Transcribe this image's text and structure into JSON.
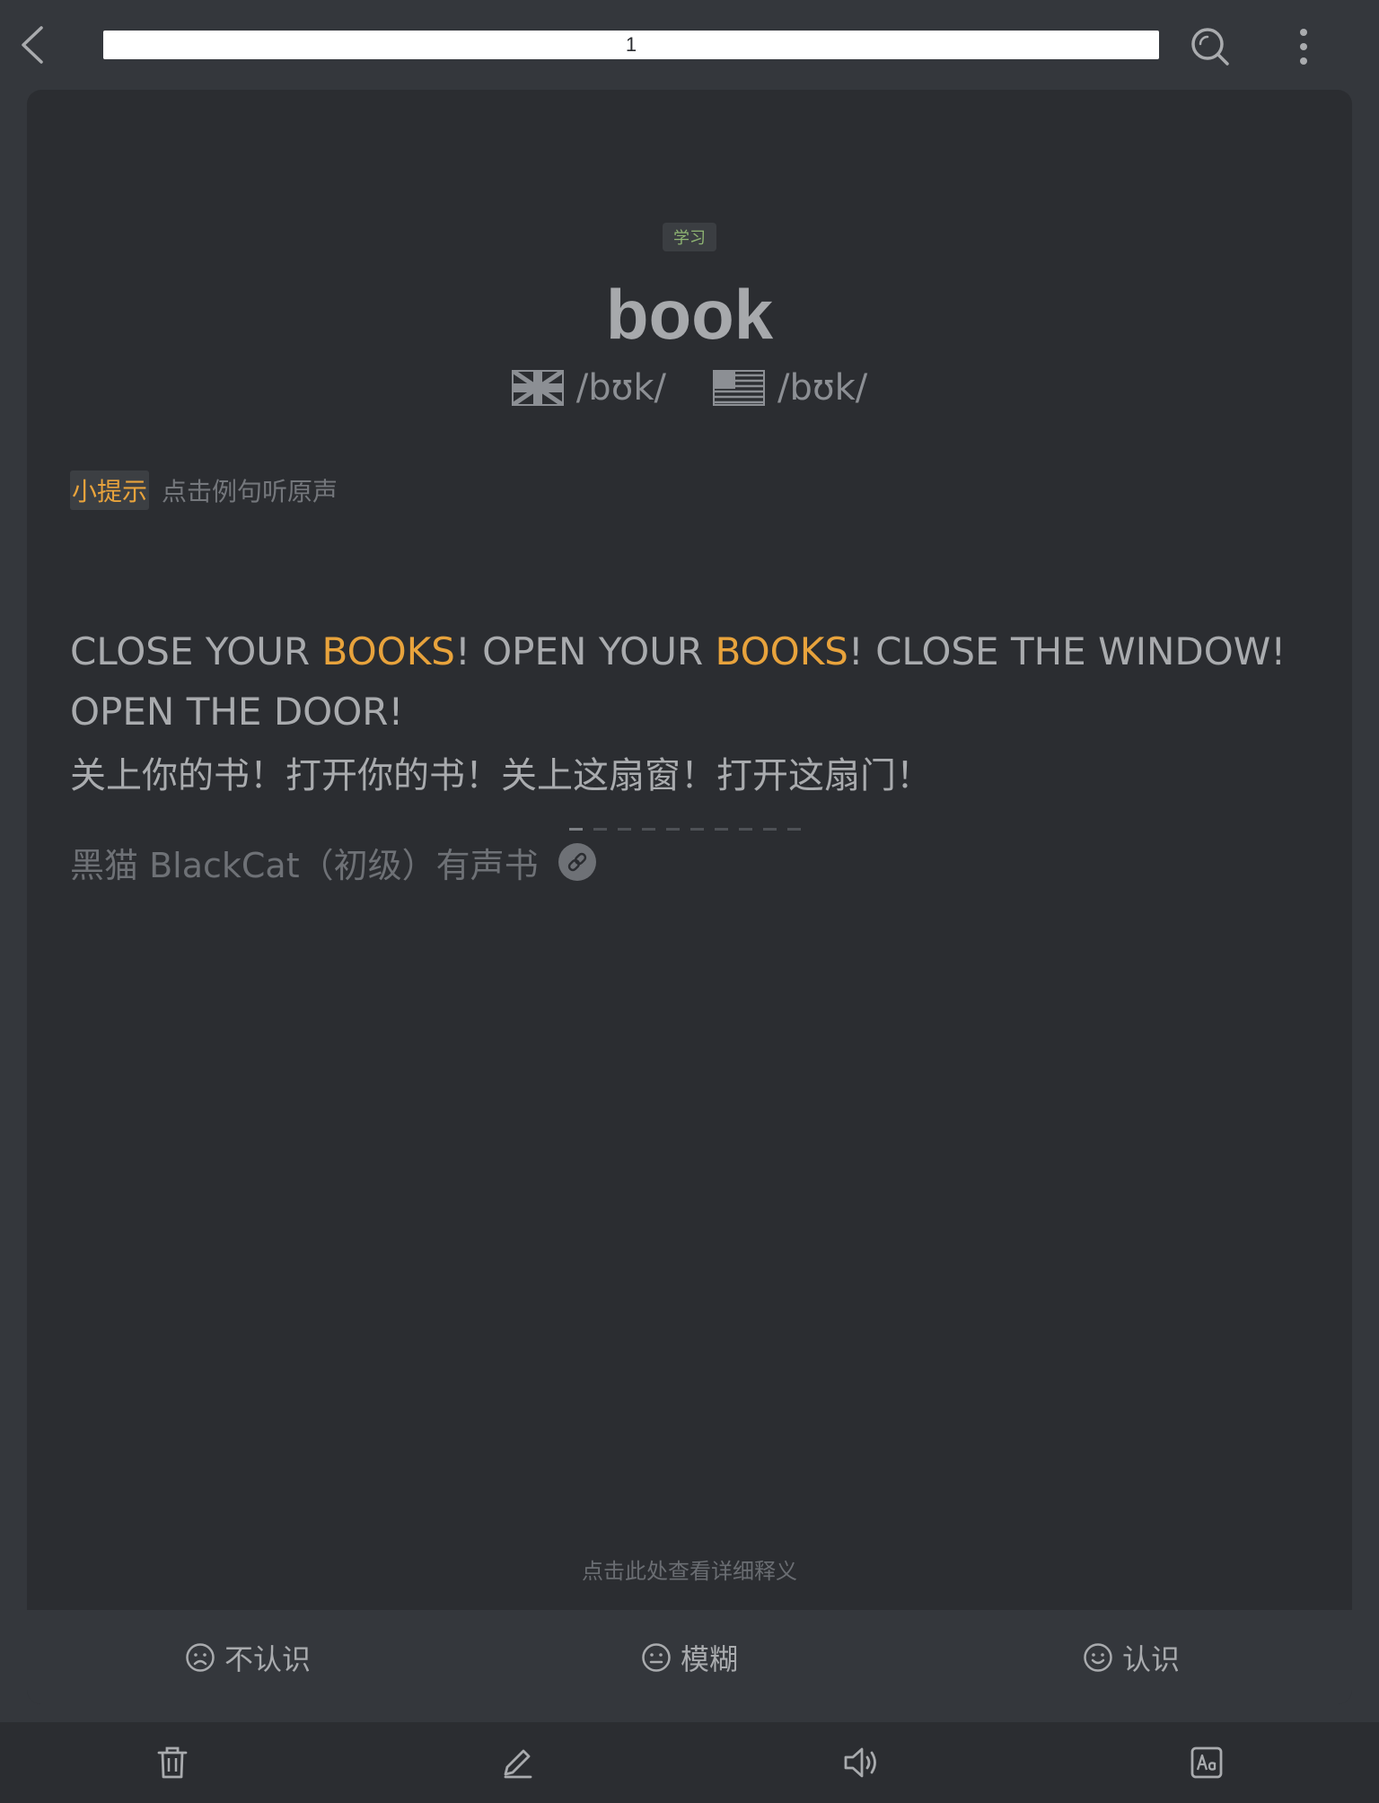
{
  "header": {
    "progress_label": "1",
    "icons": [
      "back-icon",
      "search-icon",
      "more-vertical-icon"
    ]
  },
  "card": {
    "tag": "学习",
    "word": "book",
    "phonetics": {
      "uk": "/bʊk/",
      "us": "/bʊk/"
    },
    "hint": {
      "badge": "小提示",
      "text": "点击例句听原声"
    },
    "sentence": {
      "parts": [
        "CLOSE YOUR ",
        "BOOKS",
        "! OPEN YOUR ",
        "BOOKS",
        "! CLOSE THE WINDOW! OPEN THE DOOR!"
      ],
      "highlight_color": "#e8a33c"
    },
    "translation": "关上你的书！打开你的书！关上这扇窗！打开这扇门！",
    "source": "黑猫 BlackCat（初级）有声书",
    "pager": {
      "total": 10,
      "active": 1
    },
    "detail_link": "点击此处查看详细释义"
  },
  "answers": {
    "unknown": "不认识",
    "vague": "模糊",
    "known": "认识"
  },
  "toolbar": {
    "icons": [
      "trash-icon",
      "edit-icon",
      "speaker-icon",
      "font-size-icon"
    ]
  },
  "colors": {
    "background": "#34373c",
    "card": "#2b2d31",
    "accent": "#e8a33c",
    "tag_text": "#8fb573"
  }
}
